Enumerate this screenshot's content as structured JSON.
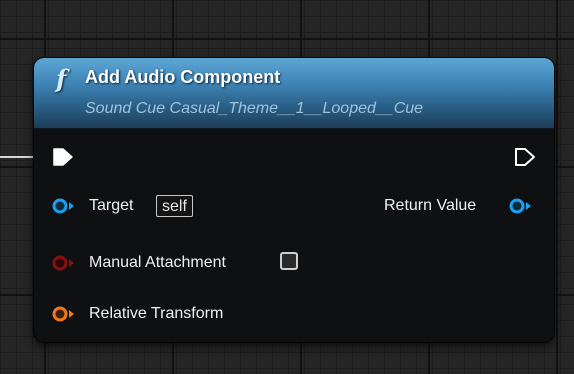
{
  "node": {
    "function_symbol": "f",
    "title": "Add Audio Component",
    "subtitle": "Sound Cue Casual_Theme__1__Looped__Cue"
  },
  "pins": {
    "target_label": "Target",
    "target_default": "self",
    "return_label": "Return Value",
    "manual_attachment_label": "Manual Attachment",
    "manual_attachment_checked": false,
    "relative_transform_label": "Relative Transform"
  },
  "colors": {
    "object_pin": "#1aa0f0",
    "bool_pin": "#8a1010",
    "transform_pin": "#f07a1a",
    "exec_pin": "#ffffff",
    "header_accent": "#3f86b8"
  },
  "icons": {
    "function": "function-icon",
    "exec_in": "exec-arrow-filled-icon",
    "exec_out": "exec-arrow-outline-icon",
    "checkbox": "checkbox-icon"
  }
}
